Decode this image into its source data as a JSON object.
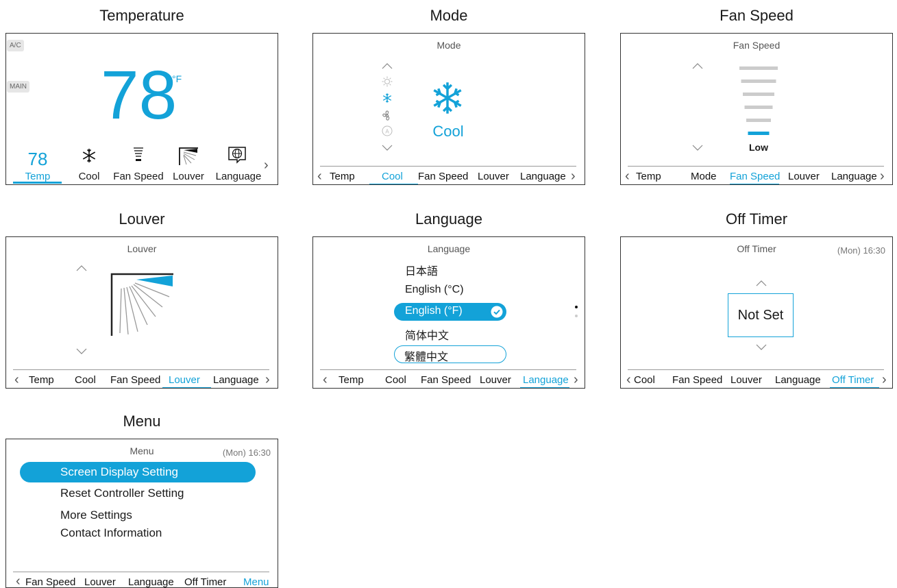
{
  "captions": {
    "temperature": "Temperature",
    "mode": "Mode",
    "fan_speed": "Fan Speed",
    "louver": "Louver",
    "language": "Language",
    "off_timer": "Off Timer",
    "menu": "Menu"
  },
  "temperature_screen": {
    "ac_badge": "A/C",
    "main_badge": "MAIN",
    "value": "78",
    "unit": "°F",
    "tabs": [
      {
        "value": "78",
        "label": "Temp"
      },
      {
        "icon": "snowflake-icon",
        "label": "Cool"
      },
      {
        "icon": "fan-speed-icon",
        "label": "Fan Speed"
      },
      {
        "icon": "louver-icon",
        "label": "Louver"
      },
      {
        "icon": "globe-icon",
        "label": "Language"
      }
    ],
    "active_tab": "Temp"
  },
  "mode_screen": {
    "title": "Mode",
    "mode_icons": [
      "sun-icon",
      "snowflake-icon",
      "fan-icon",
      "auto-icon"
    ],
    "selected_label": "Cool",
    "tabs": [
      "Temp",
      "Cool",
      "Fan Speed",
      "Louver",
      "Language"
    ],
    "active_tab": "Cool"
  },
  "fan_speed_screen": {
    "title": "Fan Speed",
    "levels": 6,
    "current_level": 1,
    "current_label": "Low",
    "tabs": [
      "Temp",
      "Mode",
      "Fan Speed",
      "Louver",
      "Language"
    ],
    "active_tab": "Fan Speed"
  },
  "louver_screen": {
    "title": "Louver",
    "tabs": [
      "Temp",
      "Cool",
      "Fan Speed",
      "Louver",
      "Language"
    ],
    "active_tab": "Louver"
  },
  "language_screen": {
    "title": "Language",
    "options": [
      "日本語",
      "English (°C)",
      "English (°F)",
      "简体中文",
      "繁體中文"
    ],
    "selected": "English (°F)",
    "tabs": [
      "Temp",
      "Cool",
      "Fan Speed",
      "Louver",
      "Language"
    ],
    "active_tab": "Language"
  },
  "off_timer_screen": {
    "title": "Off Timer",
    "clock": "(Mon) 16:30",
    "value": "Not Set",
    "tabs": [
      "Cool",
      "Fan Speed",
      "Louver",
      "Language",
      "Off Timer"
    ],
    "active_tab": "Off Timer"
  },
  "menu_screen": {
    "title": "Menu",
    "clock": "(Mon) 16:30",
    "items": [
      "Screen Display Setting",
      "Reset Controller Setting",
      "More Settings",
      "Contact Information"
    ],
    "selected": "Screen Display Setting",
    "tabs": [
      "Fan Speed",
      "Louver",
      "Language",
      "Off Timer",
      "Menu"
    ],
    "active_tab": "Menu"
  },
  "colors": {
    "accent": "#13a2d8",
    "border": "#333333",
    "muted": "#cccccc"
  }
}
